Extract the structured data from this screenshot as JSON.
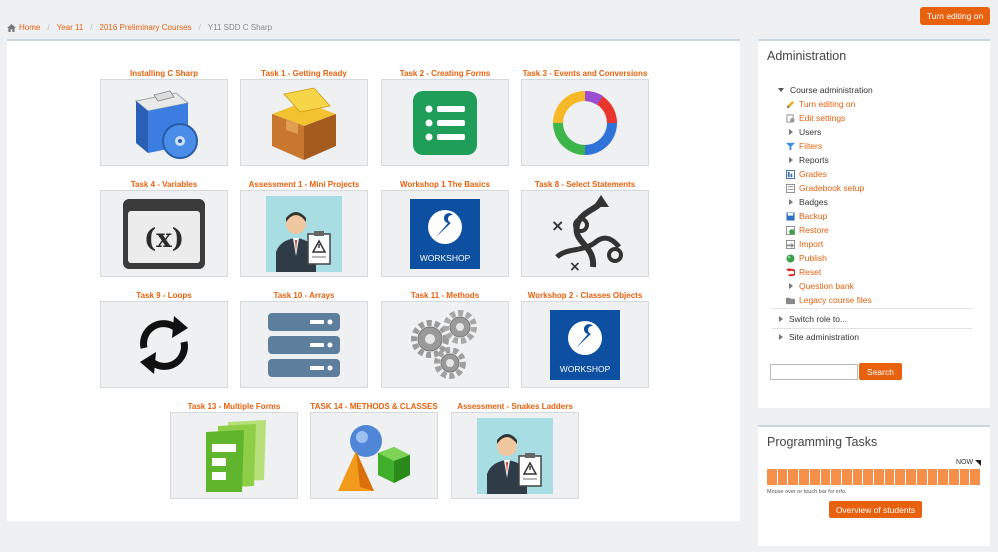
{
  "breadcrumb": [
    "Home",
    "Year 11",
    "2016 Preliminary Courses",
    "Y11 SDD C Sharp"
  ],
  "edit_button": "Turn editing on",
  "tiles": [
    {
      "title": "Installing C Sharp",
      "icon": "installer-icon"
    },
    {
      "title": "Task 1 - Getting Ready",
      "icon": "box-icon"
    },
    {
      "title": "Task 2 - Creating Forms",
      "icon": "form-list-icon"
    },
    {
      "title": "Task 3 - Events and Conversions",
      "icon": "cycle-arrows-icon"
    },
    {
      "title": "Task 4 - Variables",
      "icon": "variable-x-icon"
    },
    {
      "title": "Assessment 1 - Mini Projects",
      "icon": "assessment-person-icon"
    },
    {
      "title": "Workshop 1 The Basics",
      "icon": "workshop-icon"
    },
    {
      "title": "Task 8 - Select Statements",
      "icon": "decision-icon"
    },
    {
      "title": "Task 9 - Loops",
      "icon": "loop-icon"
    },
    {
      "title": "Task 10 - Arrays",
      "icon": "server-stack-icon"
    },
    {
      "title": "Task 11 - Methods",
      "icon": "gears-icon"
    },
    {
      "title": "Workshop 2 - Classes Objects",
      "icon": "workshop-icon"
    },
    {
      "title": "Task 13 - Multiple Forms",
      "icon": "forms-stack-icon"
    },
    {
      "title": "TASK 14 - METHODS & CLASSES",
      "icon": "shapes-icon"
    },
    {
      "title": "Assessment - Snakes Ladders",
      "icon": "assessment-person-icon"
    }
  ],
  "workshop_label": "WORKSHOP",
  "admin": {
    "title": "Administration",
    "course_admin": "Course administration",
    "items": [
      {
        "label": "Turn editing on",
        "icon": "pencil-icon",
        "link": true
      },
      {
        "label": "Edit settings",
        "icon": "settings-icon",
        "link": true
      },
      {
        "label": "Users",
        "icon": "expand-arrow-icon",
        "link": false
      },
      {
        "label": "Filters",
        "icon": "filter-icon",
        "link": true
      },
      {
        "label": "Reports",
        "icon": "expand-arrow-icon",
        "link": false
      },
      {
        "label": "Grades",
        "icon": "grades-icon",
        "link": true
      },
      {
        "label": "Gradebook setup",
        "icon": "gradebook-icon",
        "link": true
      },
      {
        "label": "Badges",
        "icon": "expand-arrow-icon",
        "link": false
      },
      {
        "label": "Backup",
        "icon": "backup-icon",
        "link": true
      },
      {
        "label": "Restore",
        "icon": "restore-icon",
        "link": true
      },
      {
        "label": "Import",
        "icon": "import-icon",
        "link": true
      },
      {
        "label": "Publish",
        "icon": "publish-icon",
        "link": true
      },
      {
        "label": "Reset",
        "icon": "reset-icon",
        "link": true
      },
      {
        "label": "Question bank",
        "icon": "expand-arrow-icon",
        "link": true
      },
      {
        "label": "Legacy course files",
        "icon": "folder-icon",
        "link": true
      }
    ],
    "switch_role": "Switch role to...",
    "site_admin": "Site administration",
    "search_button": "Search",
    "search_value": ""
  },
  "programming": {
    "title": "Programming Tasks",
    "now": "NOW",
    "cells": 20,
    "hint": "Mouse over or touch bar for info.",
    "overview_button": "Overview of students"
  },
  "colors": {
    "accent": "#e8610f",
    "progress": "#f5904a"
  }
}
